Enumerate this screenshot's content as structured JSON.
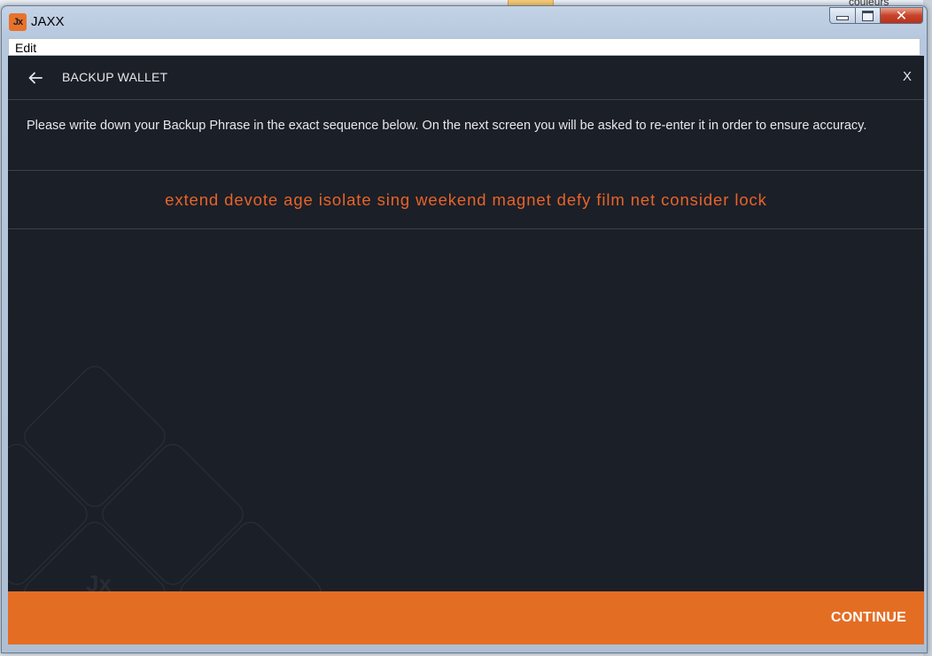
{
  "background": {
    "partial_text": "couleurs"
  },
  "window": {
    "title": "JAXX",
    "icon": "jaxx-logo-icon",
    "icon_text": "Jx",
    "controls": {
      "minimize": "minimize-icon",
      "maximize": "maximize-icon",
      "close": "✕"
    }
  },
  "menu": {
    "items": [
      {
        "label": "Edit"
      }
    ]
  },
  "header": {
    "back_icon": "arrow-left-icon",
    "title": "BACKUP WALLET",
    "close_label": "X"
  },
  "instructions": "Please write down your Backup Phrase in the exact sequence below. On the next screen you will be asked to re-enter it in order to ensure accuracy.",
  "backup_phrase": "extend devote age isolate sing weekend magnet defy film net consider lock",
  "footer": {
    "continue_label": "CONTINUE"
  },
  "colors": {
    "app_background": "#1b1f27",
    "accent": "#e46d24",
    "phrase_text": "#e8632a",
    "text": "#e6e8eb",
    "divider": "#3c424d"
  }
}
